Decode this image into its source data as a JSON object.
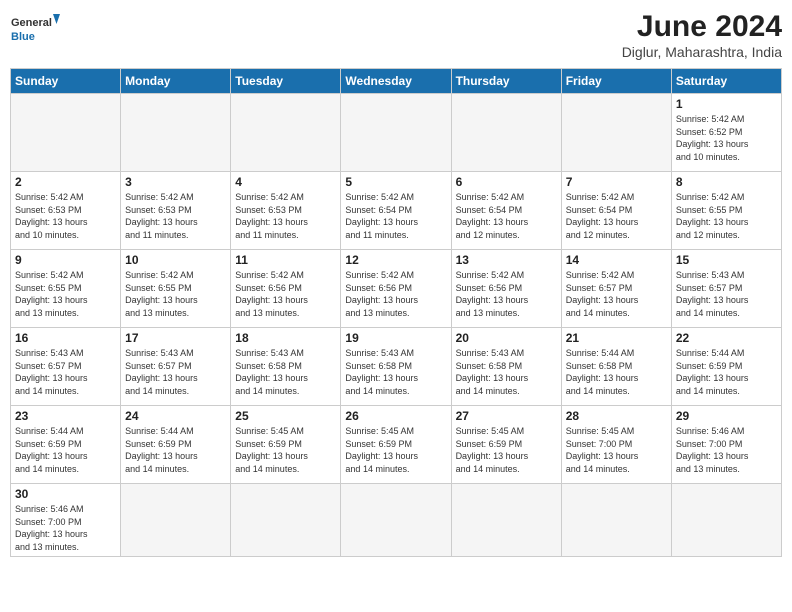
{
  "logo": {
    "general": "General",
    "blue": "Blue"
  },
  "title": "June 2024",
  "subtitle": "Diglur, Maharashtra, India",
  "days_of_week": [
    "Sunday",
    "Monday",
    "Tuesday",
    "Wednesday",
    "Thursday",
    "Friday",
    "Saturday"
  ],
  "weeks": [
    [
      {
        "day": "",
        "info": "",
        "empty": true
      },
      {
        "day": "",
        "info": "",
        "empty": true
      },
      {
        "day": "",
        "info": "",
        "empty": true
      },
      {
        "day": "",
        "info": "",
        "empty": true
      },
      {
        "day": "",
        "info": "",
        "empty": true
      },
      {
        "day": "",
        "info": "",
        "empty": true
      },
      {
        "day": "1",
        "info": "Sunrise: 5:42 AM\nSunset: 6:52 PM\nDaylight: 13 hours\nand 10 minutes."
      }
    ],
    [
      {
        "day": "2",
        "info": "Sunrise: 5:42 AM\nSunset: 6:53 PM\nDaylight: 13 hours\nand 10 minutes."
      },
      {
        "day": "3",
        "info": "Sunrise: 5:42 AM\nSunset: 6:53 PM\nDaylight: 13 hours\nand 11 minutes."
      },
      {
        "day": "4",
        "info": "Sunrise: 5:42 AM\nSunset: 6:53 PM\nDaylight: 13 hours\nand 11 minutes."
      },
      {
        "day": "5",
        "info": "Sunrise: 5:42 AM\nSunset: 6:54 PM\nDaylight: 13 hours\nand 11 minutes."
      },
      {
        "day": "6",
        "info": "Sunrise: 5:42 AM\nSunset: 6:54 PM\nDaylight: 13 hours\nand 12 minutes."
      },
      {
        "day": "7",
        "info": "Sunrise: 5:42 AM\nSunset: 6:54 PM\nDaylight: 13 hours\nand 12 minutes."
      },
      {
        "day": "8",
        "info": "Sunrise: 5:42 AM\nSunset: 6:55 PM\nDaylight: 13 hours\nand 12 minutes."
      }
    ],
    [
      {
        "day": "9",
        "info": "Sunrise: 5:42 AM\nSunset: 6:55 PM\nDaylight: 13 hours\nand 13 minutes."
      },
      {
        "day": "10",
        "info": "Sunrise: 5:42 AM\nSunset: 6:55 PM\nDaylight: 13 hours\nand 13 minutes."
      },
      {
        "day": "11",
        "info": "Sunrise: 5:42 AM\nSunset: 6:56 PM\nDaylight: 13 hours\nand 13 minutes."
      },
      {
        "day": "12",
        "info": "Sunrise: 5:42 AM\nSunset: 6:56 PM\nDaylight: 13 hours\nand 13 minutes."
      },
      {
        "day": "13",
        "info": "Sunrise: 5:42 AM\nSunset: 6:56 PM\nDaylight: 13 hours\nand 13 minutes."
      },
      {
        "day": "14",
        "info": "Sunrise: 5:42 AM\nSunset: 6:57 PM\nDaylight: 13 hours\nand 14 minutes."
      },
      {
        "day": "15",
        "info": "Sunrise: 5:43 AM\nSunset: 6:57 PM\nDaylight: 13 hours\nand 14 minutes."
      }
    ],
    [
      {
        "day": "16",
        "info": "Sunrise: 5:43 AM\nSunset: 6:57 PM\nDaylight: 13 hours\nand 14 minutes."
      },
      {
        "day": "17",
        "info": "Sunrise: 5:43 AM\nSunset: 6:57 PM\nDaylight: 13 hours\nand 14 minutes."
      },
      {
        "day": "18",
        "info": "Sunrise: 5:43 AM\nSunset: 6:58 PM\nDaylight: 13 hours\nand 14 minutes."
      },
      {
        "day": "19",
        "info": "Sunrise: 5:43 AM\nSunset: 6:58 PM\nDaylight: 13 hours\nand 14 minutes."
      },
      {
        "day": "20",
        "info": "Sunrise: 5:43 AM\nSunset: 6:58 PM\nDaylight: 13 hours\nand 14 minutes."
      },
      {
        "day": "21",
        "info": "Sunrise: 5:44 AM\nSunset: 6:58 PM\nDaylight: 13 hours\nand 14 minutes."
      },
      {
        "day": "22",
        "info": "Sunrise: 5:44 AM\nSunset: 6:59 PM\nDaylight: 13 hours\nand 14 minutes."
      }
    ],
    [
      {
        "day": "23",
        "info": "Sunrise: 5:44 AM\nSunset: 6:59 PM\nDaylight: 13 hours\nand 14 minutes."
      },
      {
        "day": "24",
        "info": "Sunrise: 5:44 AM\nSunset: 6:59 PM\nDaylight: 13 hours\nand 14 minutes."
      },
      {
        "day": "25",
        "info": "Sunrise: 5:45 AM\nSunset: 6:59 PM\nDaylight: 13 hours\nand 14 minutes."
      },
      {
        "day": "26",
        "info": "Sunrise: 5:45 AM\nSunset: 6:59 PM\nDaylight: 13 hours\nand 14 minutes."
      },
      {
        "day": "27",
        "info": "Sunrise: 5:45 AM\nSunset: 6:59 PM\nDaylight: 13 hours\nand 14 minutes."
      },
      {
        "day": "28",
        "info": "Sunrise: 5:45 AM\nSunset: 7:00 PM\nDaylight: 13 hours\nand 14 minutes."
      },
      {
        "day": "29",
        "info": "Sunrise: 5:46 AM\nSunset: 7:00 PM\nDaylight: 13 hours\nand 13 minutes."
      }
    ],
    [
      {
        "day": "30",
        "info": "Sunrise: 5:46 AM\nSunset: 7:00 PM\nDaylight: 13 hours\nand 13 minutes."
      },
      {
        "day": "",
        "info": "",
        "empty": true
      },
      {
        "day": "",
        "info": "",
        "empty": true
      },
      {
        "day": "",
        "info": "",
        "empty": true
      },
      {
        "day": "",
        "info": "",
        "empty": true
      },
      {
        "day": "",
        "info": "",
        "empty": true
      },
      {
        "day": "",
        "info": "",
        "empty": true
      }
    ]
  ]
}
